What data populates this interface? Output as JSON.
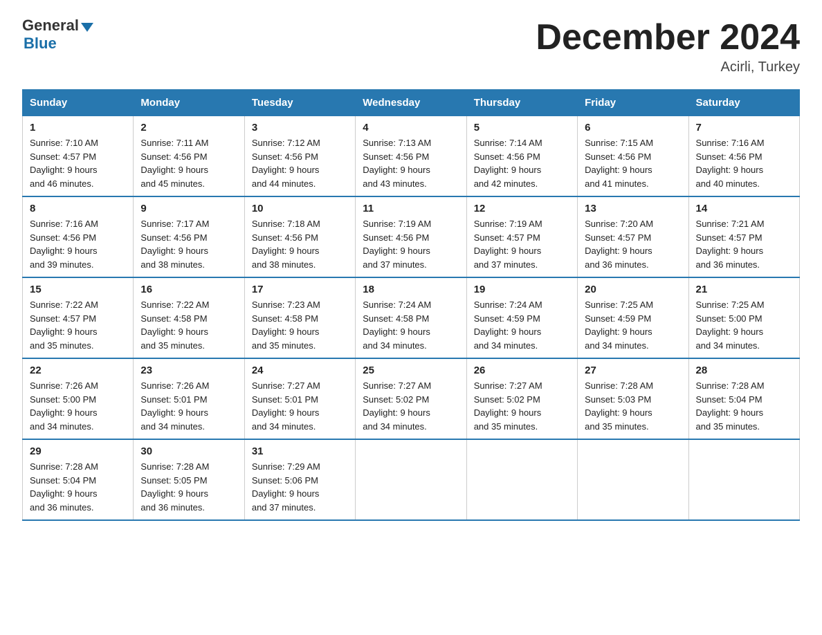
{
  "header": {
    "logo_general": "General",
    "logo_blue": "Blue",
    "main_title": "December 2024",
    "subtitle": "Acirli, Turkey"
  },
  "weekdays": [
    "Sunday",
    "Monday",
    "Tuesday",
    "Wednesday",
    "Thursday",
    "Friday",
    "Saturday"
  ],
  "weeks": [
    [
      {
        "day": "1",
        "sunrise": "7:10 AM",
        "sunset": "4:57 PM",
        "daylight": "9 hours and 46 minutes."
      },
      {
        "day": "2",
        "sunrise": "7:11 AM",
        "sunset": "4:56 PM",
        "daylight": "9 hours and 45 minutes."
      },
      {
        "day": "3",
        "sunrise": "7:12 AM",
        "sunset": "4:56 PM",
        "daylight": "9 hours and 44 minutes."
      },
      {
        "day": "4",
        "sunrise": "7:13 AM",
        "sunset": "4:56 PM",
        "daylight": "9 hours and 43 minutes."
      },
      {
        "day": "5",
        "sunrise": "7:14 AM",
        "sunset": "4:56 PM",
        "daylight": "9 hours and 42 minutes."
      },
      {
        "day": "6",
        "sunrise": "7:15 AM",
        "sunset": "4:56 PM",
        "daylight": "9 hours and 41 minutes."
      },
      {
        "day": "7",
        "sunrise": "7:16 AM",
        "sunset": "4:56 PM",
        "daylight": "9 hours and 40 minutes."
      }
    ],
    [
      {
        "day": "8",
        "sunrise": "7:16 AM",
        "sunset": "4:56 PM",
        "daylight": "9 hours and 39 minutes."
      },
      {
        "day": "9",
        "sunrise": "7:17 AM",
        "sunset": "4:56 PM",
        "daylight": "9 hours and 38 minutes."
      },
      {
        "day": "10",
        "sunrise": "7:18 AM",
        "sunset": "4:56 PM",
        "daylight": "9 hours and 38 minutes."
      },
      {
        "day": "11",
        "sunrise": "7:19 AM",
        "sunset": "4:56 PM",
        "daylight": "9 hours and 37 minutes."
      },
      {
        "day": "12",
        "sunrise": "7:19 AM",
        "sunset": "4:57 PM",
        "daylight": "9 hours and 37 minutes."
      },
      {
        "day": "13",
        "sunrise": "7:20 AM",
        "sunset": "4:57 PM",
        "daylight": "9 hours and 36 minutes."
      },
      {
        "day": "14",
        "sunrise": "7:21 AM",
        "sunset": "4:57 PM",
        "daylight": "9 hours and 36 minutes."
      }
    ],
    [
      {
        "day": "15",
        "sunrise": "7:22 AM",
        "sunset": "4:57 PM",
        "daylight": "9 hours and 35 minutes."
      },
      {
        "day": "16",
        "sunrise": "7:22 AM",
        "sunset": "4:58 PM",
        "daylight": "9 hours and 35 minutes."
      },
      {
        "day": "17",
        "sunrise": "7:23 AM",
        "sunset": "4:58 PM",
        "daylight": "9 hours and 35 minutes."
      },
      {
        "day": "18",
        "sunrise": "7:24 AM",
        "sunset": "4:58 PM",
        "daylight": "9 hours and 34 minutes."
      },
      {
        "day": "19",
        "sunrise": "7:24 AM",
        "sunset": "4:59 PM",
        "daylight": "9 hours and 34 minutes."
      },
      {
        "day": "20",
        "sunrise": "7:25 AM",
        "sunset": "4:59 PM",
        "daylight": "9 hours and 34 minutes."
      },
      {
        "day": "21",
        "sunrise": "7:25 AM",
        "sunset": "5:00 PM",
        "daylight": "9 hours and 34 minutes."
      }
    ],
    [
      {
        "day": "22",
        "sunrise": "7:26 AM",
        "sunset": "5:00 PM",
        "daylight": "9 hours and 34 minutes."
      },
      {
        "day": "23",
        "sunrise": "7:26 AM",
        "sunset": "5:01 PM",
        "daylight": "9 hours and 34 minutes."
      },
      {
        "day": "24",
        "sunrise": "7:27 AM",
        "sunset": "5:01 PM",
        "daylight": "9 hours and 34 minutes."
      },
      {
        "day": "25",
        "sunrise": "7:27 AM",
        "sunset": "5:02 PM",
        "daylight": "9 hours and 34 minutes."
      },
      {
        "day": "26",
        "sunrise": "7:27 AM",
        "sunset": "5:02 PM",
        "daylight": "9 hours and 35 minutes."
      },
      {
        "day": "27",
        "sunrise": "7:28 AM",
        "sunset": "5:03 PM",
        "daylight": "9 hours and 35 minutes."
      },
      {
        "day": "28",
        "sunrise": "7:28 AM",
        "sunset": "5:04 PM",
        "daylight": "9 hours and 35 minutes."
      }
    ],
    [
      {
        "day": "29",
        "sunrise": "7:28 AM",
        "sunset": "5:04 PM",
        "daylight": "9 hours and 36 minutes."
      },
      {
        "day": "30",
        "sunrise": "7:28 AM",
        "sunset": "5:05 PM",
        "daylight": "9 hours and 36 minutes."
      },
      {
        "day": "31",
        "sunrise": "7:29 AM",
        "sunset": "5:06 PM",
        "daylight": "9 hours and 37 minutes."
      },
      null,
      null,
      null,
      null
    ]
  ],
  "labels": {
    "sunrise": "Sunrise:",
    "sunset": "Sunset:",
    "daylight": "Daylight:"
  }
}
